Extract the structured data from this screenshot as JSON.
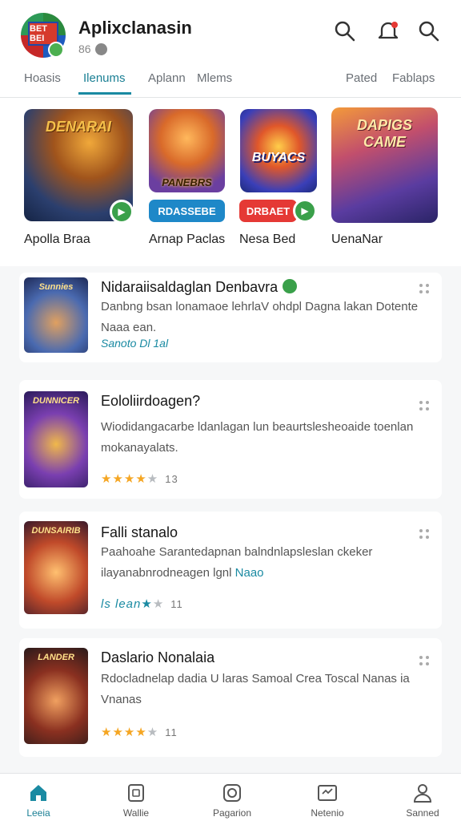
{
  "header": {
    "logo_text": "BET BEI",
    "title": "Aplixclanasin",
    "subtitle": "86"
  },
  "tabs": [
    {
      "label": "Hoasis"
    },
    {
      "label": "Ilenums"
    },
    {
      "label": "Aplann"
    },
    {
      "label": "Mlems"
    },
    {
      "label": "Pated"
    },
    {
      "label": "Fablaps"
    }
  ],
  "featured": [
    {
      "art_text": "DENARAI",
      "label": "Apolla Braa"
    },
    {
      "art_text": "PANEBRS",
      "button": "RDASSEBE",
      "label": "Arnap Paclas"
    },
    {
      "art_text": "BUYACS",
      "button": "DRBAET",
      "label": "Nesa Bed"
    },
    {
      "art_text": "DAPIGS CAME",
      "label": "UenaNar"
    }
  ],
  "list": [
    {
      "thumb_text": "Sunnies",
      "title": "Nidaraiisaldaglan Denbavra",
      "desc": "Danbng bsan lonamaoe lehrlaV ohdpl Dagna lakan Dotente Naaa ean.",
      "meta": "Sanoto Dl 1al"
    },
    {
      "thumb_text": "DUNNICER",
      "title": "Eololiirdoagen?",
      "desc": "Wiodidangacarbe ldanlagan lun beaurtslesheoaide toenlan mokanayalats.",
      "rating": 4,
      "count": "13"
    },
    {
      "thumb_text": "DUNSAIRIB",
      "title": "Falli stanalo",
      "desc": "Paahoahe Sarantedapnan balndnlapsleslan ckeker ilayanabnrodneagen lgnl",
      "desc_link": "Naao",
      "meta": "ls lean",
      "rating": 4,
      "count": "11"
    },
    {
      "thumb_text": "LANDER",
      "title": "Daslario Nonalaia",
      "desc": "Rdocladnelap dadia U laras Samoal Crea Toscal Nanas ia Vnanas",
      "rating": 4,
      "count": "11"
    }
  ],
  "bottom_nav": [
    {
      "label": "Leeia",
      "icon": "home-icon"
    },
    {
      "label": "Wallie",
      "icon": "wallet-icon"
    },
    {
      "label": "Pagarion",
      "icon": "camera-icon"
    },
    {
      "label": "Netenio",
      "icon": "network-icon"
    },
    {
      "label": "Sanned",
      "icon": "profile-icon"
    }
  ],
  "colors": {
    "accent": "#1a8aa2",
    "star": "#f5a623",
    "green": "#3aa04a",
    "red": "#e53935",
    "blue": "#1e88c8"
  }
}
